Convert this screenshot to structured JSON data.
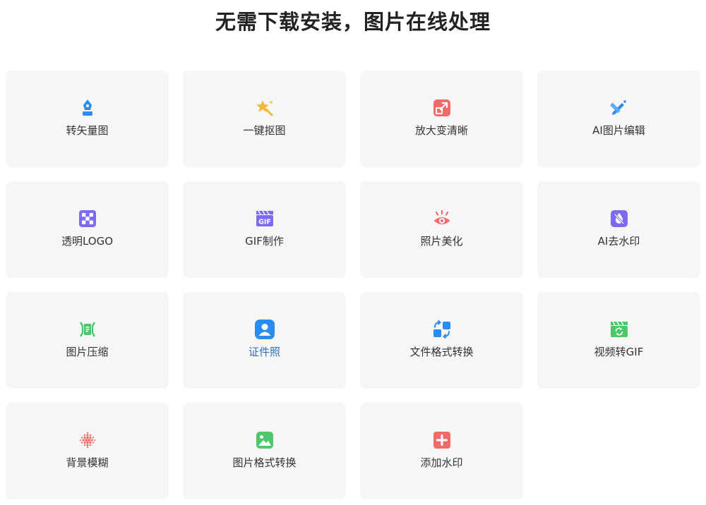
{
  "header": {
    "title": "无需下载安装，图片在线处理"
  },
  "tools": [
    {
      "label": "转矢量图",
      "icon": "vector-pen-icon",
      "color": "#2b8cf0"
    },
    {
      "label": "一键抠图",
      "icon": "magic-star-icon",
      "color": "#f5b83d"
    },
    {
      "label": "放大变清晰",
      "icon": "enlarge-arrow-icon",
      "color": "#f26b6b"
    },
    {
      "label": "AI图片编辑",
      "icon": "pencil-ruler-icon",
      "color": "#2b8cf0"
    },
    {
      "label": "透明LOGO",
      "icon": "checkerboard-icon",
      "color": "#7b6cf0"
    },
    {
      "label": "GIF制作",
      "icon": "gif-clapper-icon",
      "color": "#7b6cf0"
    },
    {
      "label": "照片美化",
      "icon": "eye-icon",
      "color": "#f26b6b"
    },
    {
      "label": "AI去水印",
      "icon": "droplet-off-icon",
      "color": "#7b6cf0"
    },
    {
      "label": "图片压缩",
      "icon": "compress-icon",
      "color": "#4cc769"
    },
    {
      "label": "证件照",
      "icon": "id-photo-icon",
      "color": "#2b8cf0"
    },
    {
      "label": "文件格式转换",
      "icon": "file-convert-icon",
      "color": "#2b8cf0"
    },
    {
      "label": "视频转GIF",
      "icon": "video-convert-icon",
      "color": "#4cc769"
    },
    {
      "label": "背景模糊",
      "icon": "dot-blur-icon",
      "color": "#f26b6b"
    },
    {
      "label": "图片格式转换",
      "icon": "image-icon",
      "color": "#4cc769"
    },
    {
      "label": "添加水印",
      "icon": "plus-square-icon",
      "color": "#f26b6b"
    }
  ]
}
